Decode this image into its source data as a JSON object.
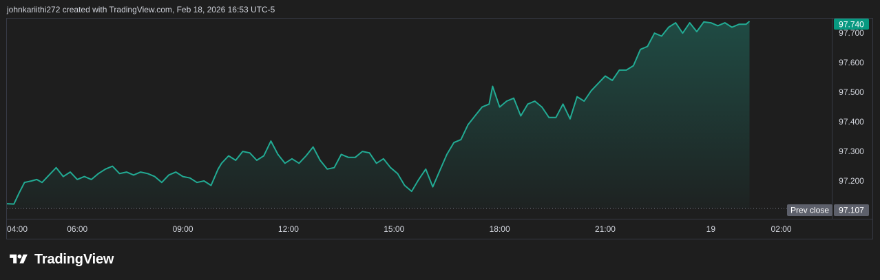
{
  "header": {
    "credit": "johnkariithi272 created with TradingView.com, Feb 18, 2026 16:53 UTC-5"
  },
  "branding": {
    "name": "TradingView",
    "icon": "tradingview-logo-icon"
  },
  "colors": {
    "background": "#1e1e1e",
    "line": "#22ab94",
    "last_price_label": "#089981",
    "prev_close_label": "#5d606b",
    "text": "#d1d4dc"
  },
  "chart_data": {
    "type": "area",
    "y_axis_side": "right",
    "ylim": [
      97.107,
      97.74
    ],
    "y_ticks": [
      97.2,
      97.3,
      97.4,
      97.5,
      97.6,
      97.7
    ],
    "y_tick_labels": [
      "97.200",
      "97.300",
      "97.400",
      "97.500",
      "97.600",
      "97.700"
    ],
    "x_ticks": [
      {
        "label": "04:00",
        "t": 0
      },
      {
        "label": "06:00",
        "t": 2
      },
      {
        "label": "09:00",
        "t": 5
      },
      {
        "label": "12:00",
        "t": 8
      },
      {
        "label": "15:00",
        "t": 11
      },
      {
        "label": "18:00",
        "t": 14
      },
      {
        "label": "21:00",
        "t": 17
      },
      {
        "label": "19",
        "t": 20
      },
      {
        "label": "02:00",
        "t": 22
      }
    ],
    "xlim": [
      0,
      22.4
    ],
    "last_price": {
      "value": 97.74,
      "label": "97.740"
    },
    "prev_close": {
      "value": 97.107,
      "label": "Prev close",
      "value_label": "97.107"
    },
    "series": [
      {
        "t": [
          0.0,
          0.2,
          0.35,
          0.5,
          0.7,
          0.85,
          1.0,
          1.2,
          1.4,
          1.6,
          1.8,
          2.0,
          2.2,
          2.4,
          2.6,
          2.8,
          3.0,
          3.2,
          3.4,
          3.6,
          3.8,
          4.0,
          4.2,
          4.4,
          4.6,
          4.8,
          5.0,
          5.2,
          5.4,
          5.6,
          5.8,
          6.0,
          6.1,
          6.3,
          6.5,
          6.7,
          6.9,
          7.1,
          7.3,
          7.5,
          7.7,
          7.9,
          8.1,
          8.3,
          8.5,
          8.7,
          8.9,
          9.1,
          9.3,
          9.5,
          9.7,
          9.9,
          10.1,
          10.3,
          10.5,
          10.7,
          10.9,
          11.1,
          11.3,
          11.5,
          11.7,
          11.9,
          12.1,
          12.3,
          12.5,
          12.7,
          12.9,
          13.1,
          13.3,
          13.5,
          13.7,
          13.8,
          14.0,
          14.2,
          14.4,
          14.6,
          14.8,
          15.0,
          15.2,
          15.4,
          15.6,
          15.8,
          16.0,
          16.2,
          16.4,
          16.6,
          16.8,
          17.0,
          17.2,
          17.4,
          17.6,
          17.8,
          18.0,
          18.2,
          18.4,
          18.6,
          18.8,
          19.0,
          19.2,
          19.4,
          19.6,
          19.8,
          20.0,
          20.2,
          20.4,
          20.6,
          20.8,
          21.0,
          21.1
        ],
        "values": [
          97.123,
          97.122,
          97.16,
          97.195,
          97.2,
          97.205,
          97.195,
          97.22,
          97.245,
          97.215,
          97.23,
          97.205,
          97.215,
          97.205,
          97.225,
          97.24,
          97.25,
          97.225,
          97.23,
          97.22,
          97.23,
          97.225,
          97.215,
          97.195,
          97.22,
          97.23,
          97.215,
          97.21,
          97.195,
          97.2,
          97.185,
          97.24,
          97.26,
          97.285,
          97.27,
          97.3,
          97.295,
          97.27,
          97.285,
          97.335,
          97.29,
          97.26,
          97.275,
          97.26,
          97.285,
          97.315,
          97.27,
          97.24,
          97.245,
          97.29,
          97.28,
          97.28,
          97.3,
          97.295,
          97.26,
          97.275,
          97.245,
          97.225,
          97.185,
          97.165,
          97.205,
          97.24,
          97.18,
          97.235,
          97.29,
          97.33,
          97.34,
          97.39,
          97.42,
          97.45,
          97.46,
          97.52,
          97.45,
          97.47,
          97.48,
          97.42,
          97.46,
          97.47,
          97.45,
          97.415,
          97.415,
          97.46,
          97.41,
          97.485,
          97.47,
          97.505,
          97.53,
          97.555,
          97.54,
          97.575,
          97.575,
          97.59,
          97.645,
          97.655,
          97.7,
          97.69,
          97.72,
          97.735,
          97.7,
          97.735,
          97.705,
          97.738,
          97.735,
          97.725,
          97.735,
          97.72,
          97.73,
          97.73,
          97.74
        ]
      }
    ]
  }
}
